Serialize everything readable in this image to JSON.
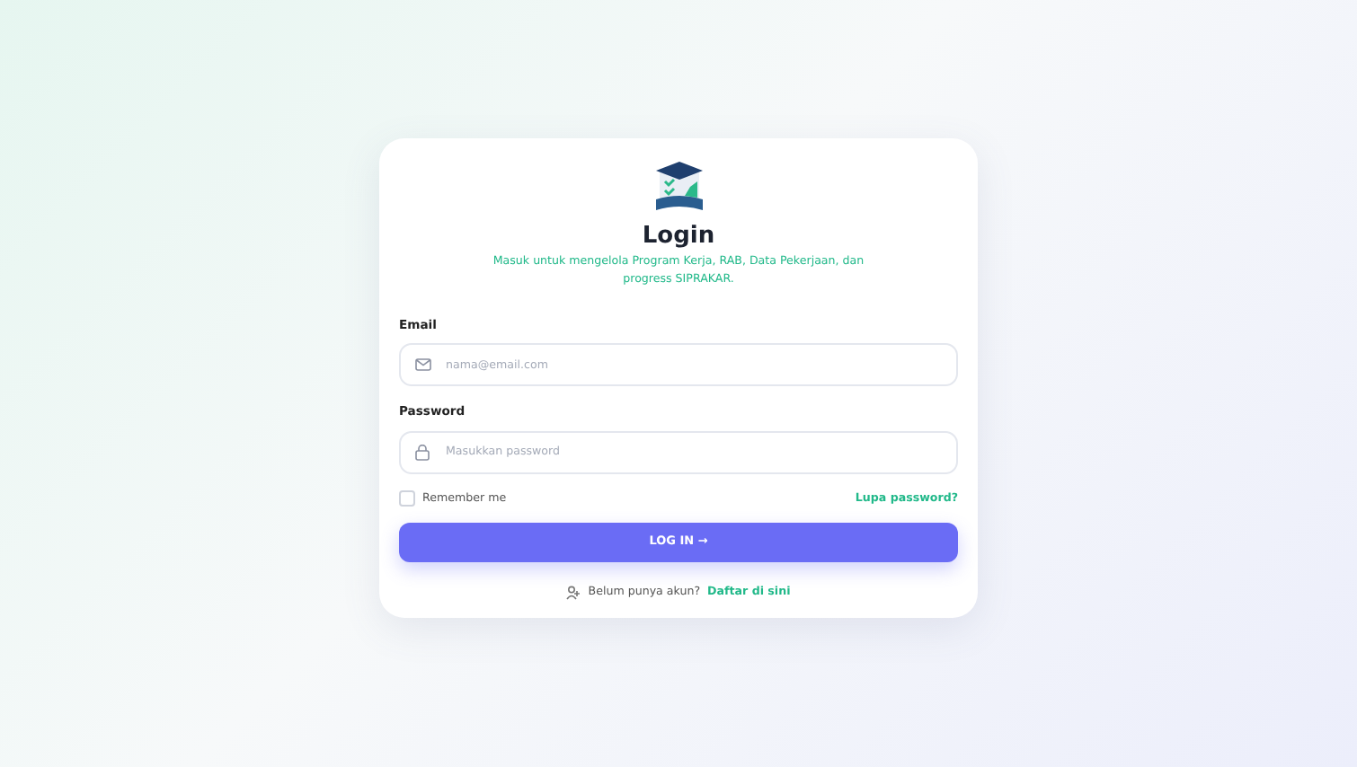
{
  "title": "Login",
  "subtitle": "Masuk untuk mengelola Program Kerja, RAB, Data Pekerjaan, dan progress SIPRAKAR.",
  "fields": [
    {
      "label": "Email",
      "kind": "email",
      "placeholder": "nama@email.com"
    },
    {
      "label": "Password",
      "kind": "password",
      "placeholder": "Masukkan password"
    }
  ],
  "remember": {
    "label": "Remember me",
    "checked": false
  },
  "forgot_link": "Lupa password?",
  "submit": "LOG IN →",
  "register": {
    "text": "Belum punya akun?",
    "link": "Daftar di sini"
  }
}
